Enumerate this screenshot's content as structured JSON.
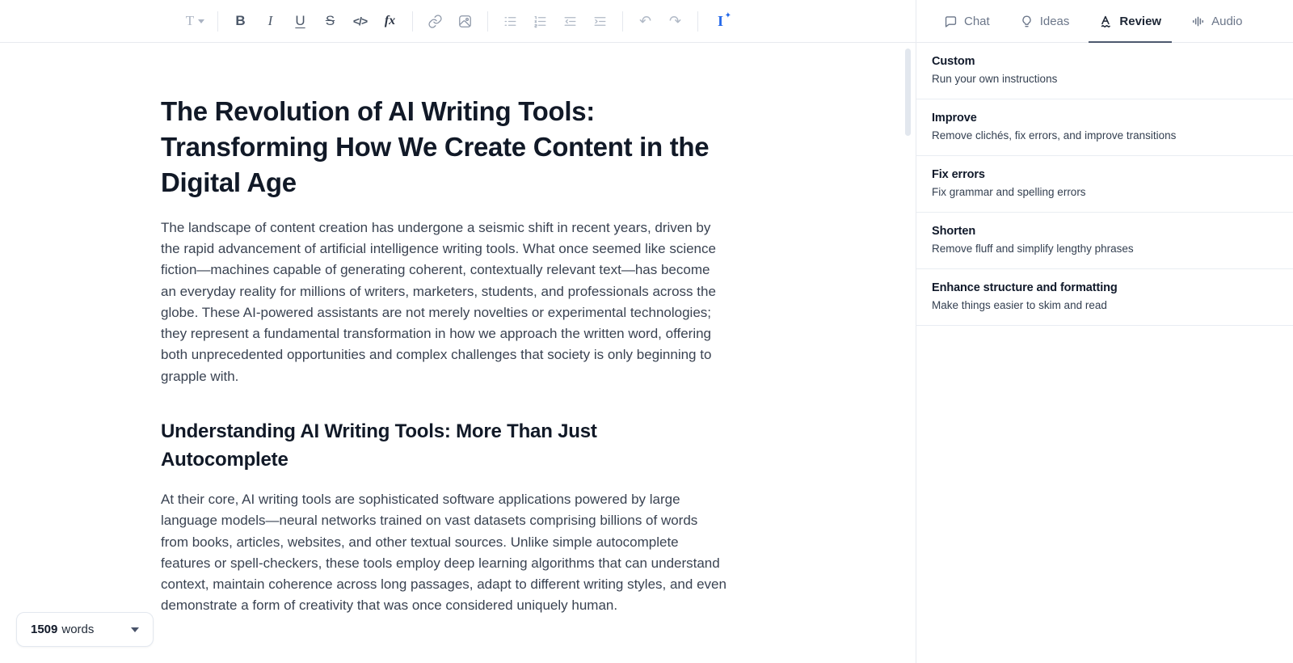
{
  "colors": {
    "accent_blue": "#2368e9",
    "active_tab_underline": "#4d596e",
    "divider": "#e7eaef"
  },
  "toolbar": {
    "text_style_glyph": "T",
    "bold_glyph": "B",
    "italic_glyph": "I",
    "underline_glyph": "U",
    "strikethrough_glyph": "S",
    "code_glyph": "</>",
    "math_glyph": "fx",
    "undo_glyph": "↶",
    "redo_glyph": "↷",
    "ai_cursor_glyph": "I",
    "ai_star_glyph": "✦"
  },
  "document": {
    "title": "The Revolution of AI Writing Tools: Transforming How We Create Content in the Digital Age",
    "paragraph_1": "The landscape of content creation has undergone a seismic shift in recent years, driven by the rapid advancement of artificial intelligence writing tools. What once seemed like science fiction—machines capable of generating coherent, contextually relevant text—has become an everyday reality for millions of writers, marketers, students, and professionals across the globe. These AI-powered assistants are not merely novelties or experimental technologies; they represent a fundamental transformation in how we approach the written word, offering both unprecedented opportunities and complex challenges that society is only beginning to grapple with.",
    "heading_2": "Understanding AI Writing Tools: More Than Just Autocomplete",
    "paragraph_2": "At their core, AI writing tools are sophisticated software applications powered by large language models—neural networks trained on vast datasets comprising billions of words from books, articles, websites, and other textual sources. Unlike simple autocomplete features or spell-checkers, these tools employ deep learning algorithms that can understand context, maintain coherence across long passages, adapt to different writing styles, and even demonstrate a form of creativity that was once considered uniquely human.",
    "word_count": "1509",
    "word_count_label": "words"
  },
  "sidebar": {
    "tabs": [
      {
        "label": "Chat",
        "icon": "chat-bubble-icon",
        "active": false
      },
      {
        "label": "Ideas",
        "icon": "lightbulb-icon",
        "active": false
      },
      {
        "label": "Review",
        "icon": "spellcheck-icon",
        "active": true
      },
      {
        "label": "Audio",
        "icon": "waveform-icon",
        "active": false
      }
    ],
    "review_actions": [
      {
        "title": "Custom",
        "description": "Run your own instructions"
      },
      {
        "title": "Improve",
        "description": "Remove clichés, fix errors, and improve transitions"
      },
      {
        "title": "Fix errors",
        "description": "Fix grammar and spelling errors"
      },
      {
        "title": "Shorten",
        "description": "Remove fluff and simplify lengthy phrases"
      },
      {
        "title": "Enhance structure and formatting",
        "description": "Make things easier to skim and read"
      }
    ]
  }
}
